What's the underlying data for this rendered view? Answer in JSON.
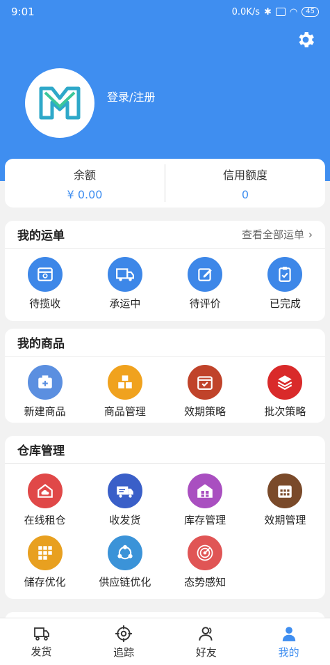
{
  "status_bar": {
    "time": "9:01",
    "speed": "0.0K/s",
    "battery": "45"
  },
  "header": {
    "login_label": "登录/注册"
  },
  "balance": {
    "balance_label": "余额",
    "balance_value": "¥ 0.00",
    "credit_label": "信用额度",
    "credit_value": "0"
  },
  "orders": {
    "title": "我的运单",
    "more": "查看全部运单",
    "items": [
      {
        "label": "待揽收",
        "icon": "box-icon",
        "color": "#3d87e8"
      },
      {
        "label": "承运中",
        "icon": "truck-icon",
        "color": "#3d87e8"
      },
      {
        "label": "待评价",
        "icon": "edit-icon",
        "color": "#3d87e8"
      },
      {
        "label": "已完成",
        "icon": "clipboard-check-icon",
        "color": "#3d87e8"
      }
    ]
  },
  "goods": {
    "title": "我的商品",
    "items": [
      {
        "label": "新建商品",
        "icon": "add-box-icon",
        "color": "#5b8fe0"
      },
      {
        "label": "商品管理",
        "icon": "boxes-icon",
        "color": "#f0a21e"
      },
      {
        "label": "效期策略",
        "icon": "calendar-check-icon",
        "color": "#c0432a"
      },
      {
        "label": "批次策略",
        "icon": "layers-icon",
        "color": "#d92a2a"
      }
    ]
  },
  "warehouse": {
    "title": "仓库管理",
    "items": [
      {
        "label": "在线租仓",
        "icon": "cloud-house-icon",
        "color": "#e04848"
      },
      {
        "label": "收发货",
        "icon": "van-icon",
        "color": "#3a5fc8"
      },
      {
        "label": "库存管理",
        "icon": "warehouse-icon",
        "color": "#a94fc0"
      },
      {
        "label": "效期管理",
        "icon": "calendar-icon",
        "color": "#7a4a2a"
      },
      {
        "label": "储存优化",
        "icon": "shelves-icon",
        "color": "#e8a020"
      },
      {
        "label": "供应链优化",
        "icon": "network-icon",
        "color": "#3b93d8"
      },
      {
        "label": "态势感知",
        "icon": "radar-icon",
        "color": "#e05555"
      }
    ]
  },
  "tabs": [
    {
      "label": "发货",
      "icon": "truck-outline-icon"
    },
    {
      "label": "追踪",
      "icon": "target-icon"
    },
    {
      "label": "好友",
      "icon": "friends-icon"
    },
    {
      "label": "我的",
      "icon": "user-icon"
    }
  ],
  "colors": {
    "primary": "#3f8ef0",
    "background": "#f2f2f2"
  }
}
